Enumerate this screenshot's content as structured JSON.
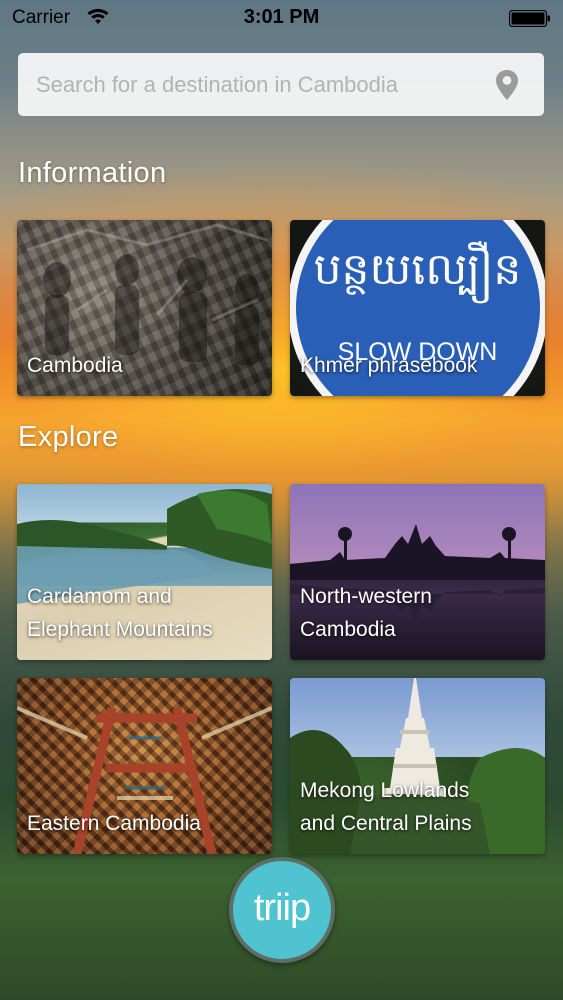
{
  "status_bar": {
    "carrier": "Carrier",
    "time": "3:01 PM",
    "wifi_icon": "wifi-icon",
    "battery_icon": "battery-icon"
  },
  "search": {
    "placeholder": "Search for a destination in Cambodia",
    "value": "",
    "icon": "location-pin-icon"
  },
  "sections": {
    "information": {
      "title": "Information",
      "tiles": [
        {
          "label": "Cambodia"
        },
        {
          "label": "Khmer phrasebook",
          "sign_khmer": "បន្ថយល្បឿន",
          "sign_english": "SLOW DOWN"
        }
      ]
    },
    "explore": {
      "title": "Explore",
      "tiles": [
        {
          "label": "Cardamom and\nElephant Mountains"
        },
        {
          "label": "North-western\nCambodia"
        },
        {
          "label": "Eastern Cambodia"
        },
        {
          "label": "Mekong Lowlands\nand Central Plains"
        }
      ]
    }
  },
  "logo": {
    "text": "triip"
  },
  "colors": {
    "logo_accent": "#4fc3cf",
    "sign_blue": "#2a5fb8"
  }
}
